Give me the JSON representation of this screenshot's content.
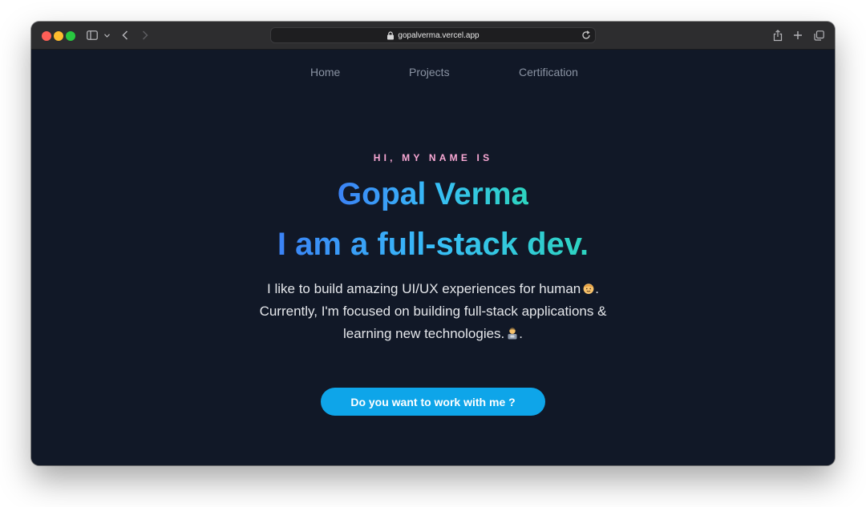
{
  "browser": {
    "url": "gopalverma.vercel.app",
    "icons": [
      "sidebar-icon",
      "chevron-down-icon",
      "back-icon",
      "forward-icon",
      "lock-icon",
      "reload-icon",
      "share-icon",
      "new-tab-icon",
      "tabs-overview-icon"
    ]
  },
  "nav": {
    "items": [
      {
        "label": "Home"
      },
      {
        "label": "Projects"
      },
      {
        "label": "Certification"
      }
    ]
  },
  "hero": {
    "greeting": "HI, MY NAME IS",
    "name": "Gopal Verma",
    "role": "I am a full-stack dev.",
    "bio_lines": [
      "I like to build amazing UI/UX experiences for human",
      "Currently, I'm focused on building full-stack applications &",
      "learning new technologies."
    ],
    "bio_punct": ".",
    "cta_label": "Do you want to work with me ?"
  },
  "colors": {
    "background": "#111827",
    "greeting": "#f9a8d4",
    "gradient_start": "#3b82f6",
    "gradient_end": "#2dd4bf",
    "cta": "#0ea5e9"
  }
}
